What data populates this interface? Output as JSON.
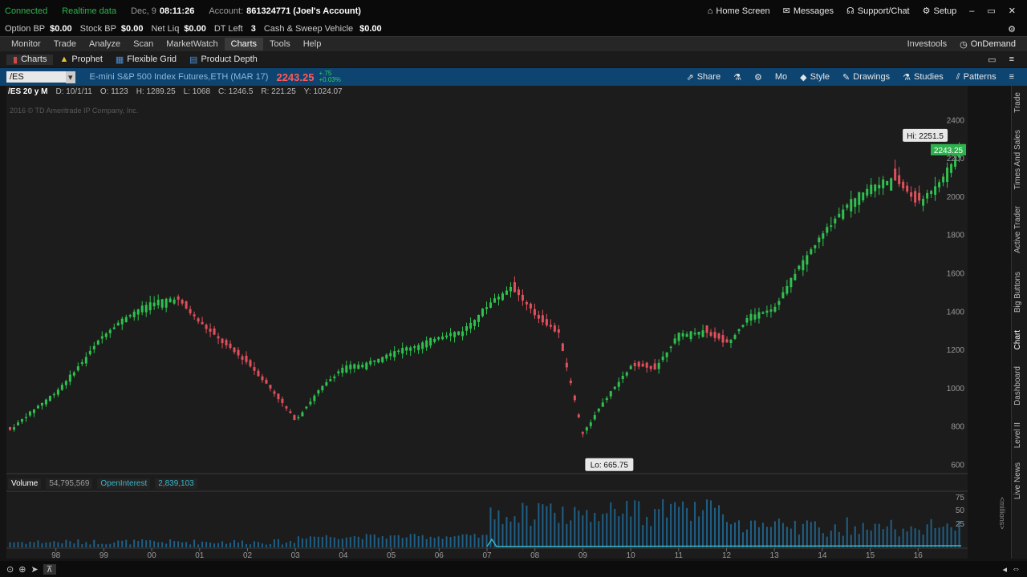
{
  "status": {
    "connected": "Connected",
    "realtime": "Realtime data",
    "date": "Dec, 9",
    "time": "08:11:26",
    "account_label": "Account:",
    "account_value": "861324771 (Joel's Account)",
    "home_screen": "Home Screen",
    "messages": "Messages",
    "support": "Support/Chat",
    "setup": "Setup"
  },
  "account": {
    "option_bp_label": "Option BP",
    "option_bp": "$0.00",
    "stock_bp_label": "Stock BP",
    "stock_bp": "$0.00",
    "net_liq_label": "Net Liq",
    "net_liq": "$0.00",
    "dt_left_label": "DT Left",
    "dt_left": "3",
    "cash_label": "Cash & Sweep Vehicle",
    "cash": "$0.00"
  },
  "menu": {
    "items": [
      "Monitor",
      "Trade",
      "Analyze",
      "Scan",
      "MarketWatch",
      "Charts",
      "Tools",
      "Help"
    ],
    "investools": "Investools",
    "ondemand": "OnDemand"
  },
  "subtoolbar": {
    "charts": "Charts",
    "prophet": "Prophet",
    "flexible_grid": "Flexible Grid",
    "product_depth": "Product Depth"
  },
  "chart_header": {
    "symbol": "/ES",
    "description": "E-mini S&P 500 Index Futures,ETH (MAR 17)",
    "price": "2243.25",
    "change": "+.75",
    "change_pct": "+0.03%",
    "share": "Share",
    "mo": "Mo",
    "style": "Style",
    "drawings": "Drawings",
    "studies": "Studies",
    "patterns": "Patterns"
  },
  "infobar": {
    "label": "/ES 20 y M",
    "d": "D: 10/1/11",
    "o": "O: 1123",
    "h": "H: 1289.25",
    "l": "L: 1068",
    "c": "C: 1246.5",
    "r": "R: 221.25",
    "y": "Y: 1024.07",
    "copyright": "2016 © TD Ameritrade IP Company, Inc."
  },
  "volume": {
    "label": "Volume",
    "value": "54,795,569",
    "oi_label": "OpenInterest",
    "oi_value": "2,839,103",
    "unit": "<millions>"
  },
  "right_rail": [
    "Trade",
    "Times And Sales",
    "Active Trader",
    "Big Buttons",
    "Chart",
    "Dashboard",
    "Level II",
    "Live News"
  ],
  "chart_data": {
    "type": "line",
    "x_label_ticks": [
      "98",
      "99",
      "00",
      "01",
      "02",
      "03",
      "04",
      "05",
      "06",
      "07",
      "08",
      "09",
      "10",
      "11",
      "12",
      "13",
      "14",
      "15",
      "16"
    ],
    "y_ticks": [
      600,
      800,
      1000,
      1200,
      1400,
      1600,
      1800,
      2000,
      2200,
      2400
    ],
    "ylim": [
      560,
      2460
    ],
    "hi_label": "Hi: 2251.5",
    "lo_label": "Lo: 665.75",
    "last_label": "2243.25",
    "vol_ticks": [
      "75",
      "50",
      "25"
    ],
    "series": [
      {
        "x": [
          1997.0,
          1997.5,
          1998.0,
          1998.5,
          1999.0,
          1999.5,
          2000.0,
          2000.5,
          2001.0,
          2001.5,
          2002.0,
          2002.5,
          2003.0,
          2003.5,
          2004.0,
          2004.5,
          2005.0,
          2005.5,
          2006.0,
          2006.5,
          2007.0,
          2007.5,
          2008.0,
          2008.5,
          2009.0,
          2009.5,
          2010.0,
          2010.5,
          2011.0,
          2011.5,
          2012.0,
          2012.5,
          2013.0,
          2013.5,
          2014.0,
          2014.5,
          2015.0,
          2015.5,
          2016.0,
          2016.5,
          2016.9
        ],
        "y": [
          770,
          880,
          980,
          1120,
          1280,
          1380,
          1450,
          1470,
          1340,
          1230,
          1130,
          990,
          830,
          990,
          1110,
          1130,
          1190,
          1220,
          1270,
          1300,
          1430,
          1530,
          1380,
          1280,
          760,
          950,
          1110,
          1100,
          1280,
          1300,
          1230,
          1380,
          1420,
          1630,
          1800,
          1960,
          2060,
          2090,
          1960,
          2100,
          2243
        ]
      }
    ]
  }
}
